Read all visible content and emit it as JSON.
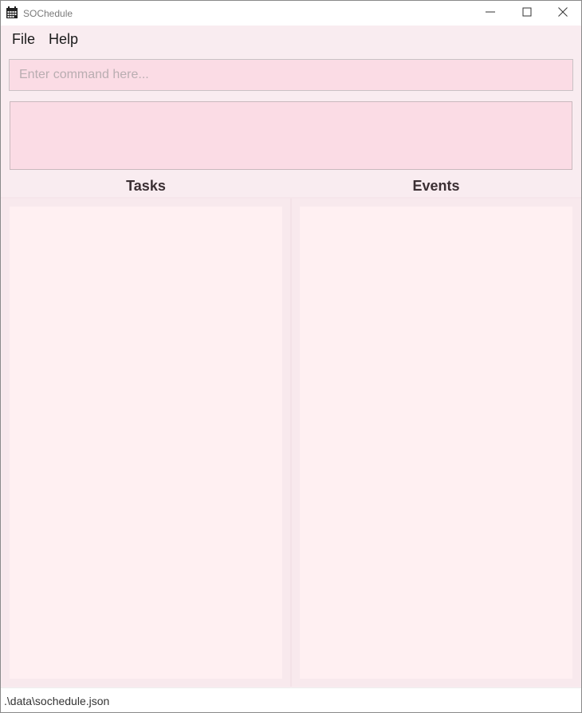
{
  "window": {
    "title": "SOChedule",
    "app_icon": "calendar-icon",
    "controls": [
      "minimize-icon",
      "maximize-icon",
      "close-icon"
    ]
  },
  "menu": {
    "items": [
      {
        "label": "File"
      },
      {
        "label": "Help"
      }
    ]
  },
  "command_box": {
    "value": "",
    "placeholder": "Enter command here..."
  },
  "result_display": {
    "text": ""
  },
  "panels": {
    "tasks": {
      "title": "Tasks",
      "items": []
    },
    "events": {
      "title": "Events",
      "items": []
    }
  },
  "status_bar": {
    "path": ".\\data\\sochedule.json"
  },
  "colors": {
    "background": "#f9ecf0",
    "input_fill": "#fbdce5",
    "panel_fill": "#fff0f2",
    "header_text": "#3b2f33"
  }
}
